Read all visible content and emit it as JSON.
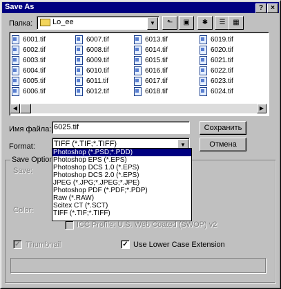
{
  "window": {
    "title": "Save As",
    "help_btn": "?",
    "close_btn": "×"
  },
  "location": {
    "label": "Папка:",
    "value": "Lo_ee"
  },
  "toolbar": [
    {
      "name": "up-folder-icon",
      "glyph": "⬑"
    },
    {
      "name": "desktop-icon",
      "glyph": "▣"
    },
    {
      "name": "new-folder-icon",
      "glyph": "✱"
    },
    {
      "name": "list-view-icon",
      "glyph": "☰"
    },
    {
      "name": "details-view-icon",
      "glyph": "▦"
    }
  ],
  "files": [
    "6001.tif",
    "6002.tif",
    "6003.tif",
    "6004.tif",
    "6005.tif",
    "6006.tif",
    "6007.tif",
    "6008.tif",
    "6009.tif",
    "6010.tif",
    "6011.tif",
    "6012.tif",
    "6013.tif",
    "6014.tif",
    "6015.tif",
    "6016.tif",
    "6017.tif",
    "6018.tif",
    "6019.tif",
    "6020.tif",
    "6021.tif",
    "6022.tif",
    "6023.tif",
    "6024.tif"
  ],
  "filename": {
    "label": "Имя файла:",
    "value": "6025.tif"
  },
  "format": {
    "label": "Format:",
    "value": "TIFF (*.TIF;*.TIFF)",
    "options": [
      "Photoshop (*.PSD;*.PDD)",
      "Photoshop EPS (*.EPS)",
      "Photoshop DCS 1.0 (*.EPS)",
      "Photoshop DCS 2.0 (*.EPS)",
      "JPEG (*.JPG;*.JPEG;*.JPE)",
      "Photoshop PDF (*.PDF;*.PDP)",
      "Raw (*.RAW)",
      "Scitex CT (*.SCT)",
      "TIFF (*.TIF;*.TIFF)"
    ],
    "selected_index": 0
  },
  "buttons": {
    "save": "Сохранить",
    "cancel": "Отмена"
  },
  "save_options": {
    "group_title": "Save Options",
    "save_label": "Save:",
    "color_label": "Color:",
    "icc_profile": "ICC Profile: U.S. Web Coated (SWOP) v2",
    "thumbnail": "Thumbnail",
    "lower_case": "Use Lower Case Extension",
    "thumbnail_checked": true,
    "lower_case_checked": true
  }
}
